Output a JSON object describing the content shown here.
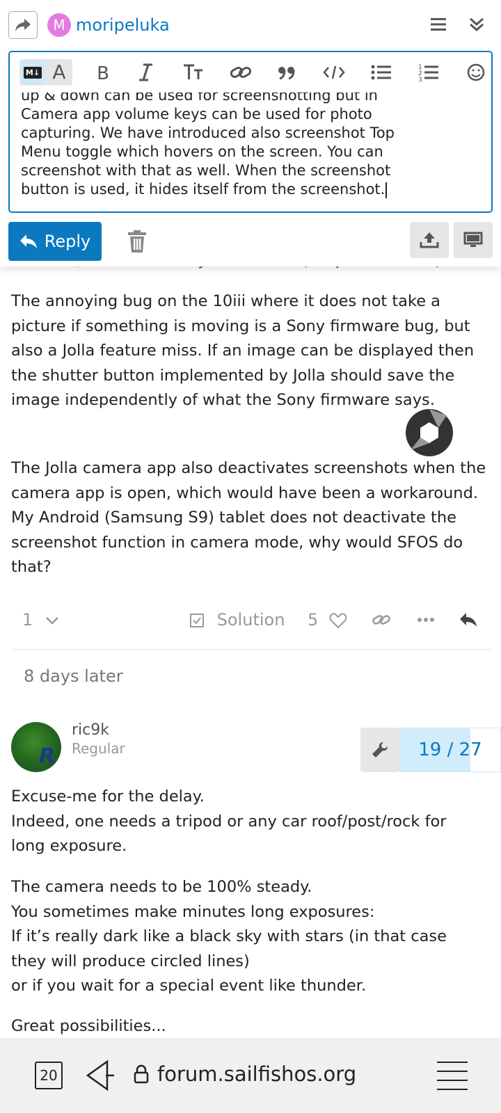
{
  "composer": {
    "username": "moripeluka",
    "avatar_letter": "M",
    "editor_lines": [
      "up & down can be used for screenshotting but in",
      "Camera app volume keys can be used for photo",
      "capturing. We have introduced also screenshot Top",
      "Menu toggle which hovers on the screen. You can",
      "screenshot with that as well. When the screenshot",
      "button is used, it hides itself from the screenshot."
    ],
    "md_badge": "M↓",
    "toggle_rich": "A",
    "reply_label": "Reply"
  },
  "post_prev": {
    "peek": "a screen, and then it only works for a (unspecified time)",
    "paragraph1": "The annoying bug on the 10iii where it does not take a picture if something is moving is a Sony firmware bug, but also a Jolla feature miss. If an image can be displayed then the shutter button implemented by Jolla should save the image independently of what the Sony firmware says.",
    "paragraph2": "The Jolla camera app also deactivates screenshots when the camera app is open, which would have been a workaround. My Android (Samsung S9) tablet does not deactivate the screenshot function in camera mode, why would SFOS do that?",
    "reply_count": "1",
    "solution_label": "Solution",
    "like_count": "5"
  },
  "time_gap": "8 days later",
  "post_next": {
    "avatar_letter": "R",
    "name": "ric9k",
    "title": "Regular",
    "lines_a": [
      "Excuse-me for the delay.",
      "Indeed, one needs a tripod or any car roof/post/rock for",
      "long exposure."
    ],
    "lines_b": [
      "The camera needs to be 100% steady.",
      "You sometimes make minutes long exposures:",
      "If it’s really dark like a black sky with stars (in that case",
      "they will produce circled lines)",
      "or if you wait for a special event like thunder."
    ],
    "line_c": "Great possibilities..."
  },
  "progress": {
    "label": "19 / 27",
    "current": 19,
    "total": 27
  },
  "browser": {
    "tab_count": "20",
    "url": "forum.sailfishos.org"
  },
  "colors": {
    "accent": "#0a79c0",
    "avatar_bg": "#e27be0"
  }
}
